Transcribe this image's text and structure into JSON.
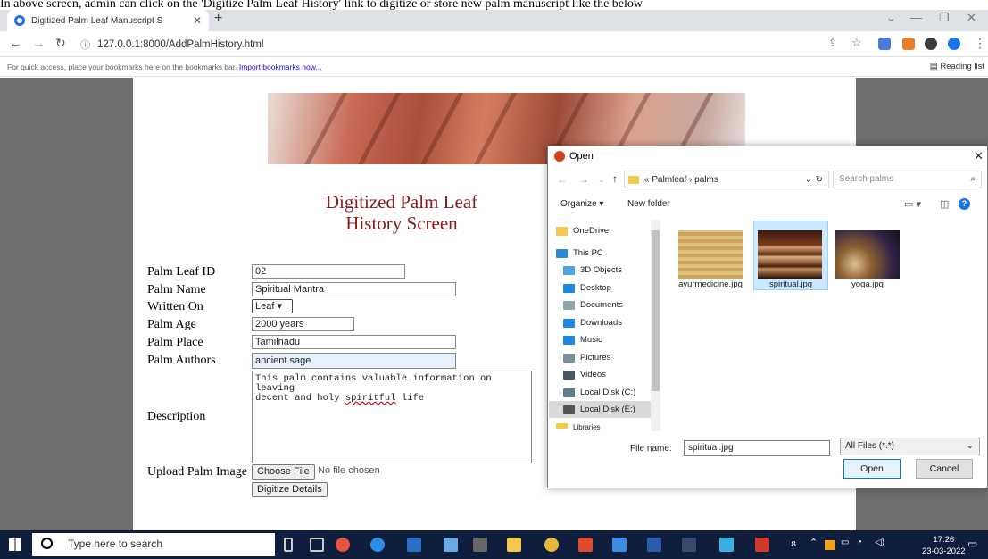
{
  "caption": "In above screen, admin can click on the 'Digitize Palm Leaf History' link to digitize or store new palm manuscript like the below",
  "browser": {
    "tab_title": "Digitized Palm Leaf Manuscript S",
    "url": "127.0.0.1:8000/AddPalmHistory.html",
    "bookmark_text": "For quick access, place your bookmarks here on the bookmarks bar.",
    "bookmark_link": "Import bookmarks now...",
    "reading_list": "Reading list"
  },
  "page": {
    "title_line1": "Digitized Palm Leaf",
    "title_line2": "History Screen",
    "labels": {
      "id": "Palm Leaf ID",
      "name": "Palm Name",
      "written": "Written On",
      "age": "Palm Age",
      "place": "Palm Place",
      "authors": "Palm Authors",
      "desc": "Description",
      "upload": "Upload Palm Image"
    },
    "values": {
      "id": "02",
      "name": "Spiritual Mantra",
      "written": "Leaf",
      "age": "2000 years",
      "place": "Tamilnadu",
      "authors": "ancient sage",
      "desc_prefix": "This palm contains valuable information on leaving\ndecent and holy ",
      "desc_misspelled": "spiritful",
      "desc_suffix": " life"
    },
    "choose_file": "Choose File",
    "no_file": "No file chosen",
    "submit": "Digitize Details"
  },
  "dialog": {
    "title": "Open",
    "crumb_root": "Palmleaf",
    "crumb_folder": "palms",
    "search_placeholder": "Search palms",
    "organize": "Organize",
    "new_folder": "New folder",
    "tree": [
      "OneDrive",
      "This PC",
      "3D Objects",
      "Desktop",
      "Documents",
      "Downloads",
      "Music",
      "Pictures",
      "Videos",
      "Local Disk (C:)",
      "Local Disk (E:)",
      "Libraries"
    ],
    "files": [
      "ayurmedicine.jpg",
      "spiritual.jpg",
      "yoga.jpg"
    ],
    "filename_label": "File name:",
    "filename_value": "spiritual.jpg",
    "filetype": "All Files (*.*)",
    "open": "Open",
    "cancel": "Cancel"
  },
  "taskbar": {
    "search": "Type here to search",
    "time": "17:26",
    "date": "23-03-2022"
  }
}
